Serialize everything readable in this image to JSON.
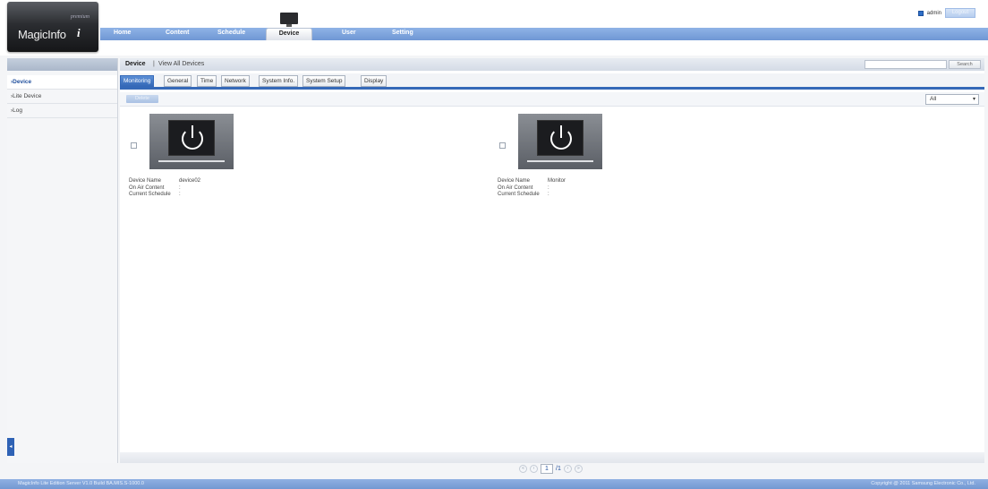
{
  "header": {
    "logo_premium": "premium",
    "logo_brand": "MagicInfo",
    "logo_i": "i",
    "nav": [
      "Home",
      "Content",
      "Schedule",
      "Device",
      "User",
      "Setting"
    ],
    "active_nav": "Device",
    "user": "admin",
    "logout": "Logout"
  },
  "sidebar": {
    "items": [
      "Device",
      "Lite Device",
      "Log"
    ],
    "toggle": "◂"
  },
  "main": {
    "title": "Device",
    "separator": "|",
    "subtitle": "View All Devices",
    "search_button": "Search",
    "search_value": "",
    "tabs": [
      "Monitoring",
      "General",
      "Time",
      "Network",
      "System Info.",
      "System Setup",
      "Display"
    ],
    "clear_button": "Delete",
    "filter_value": "All",
    "filter_arrow": "▾"
  },
  "devices": [
    {
      "name_label": "Device Name",
      "name": "device02",
      "content_label": "On Air Content",
      "content": ":",
      "schedule_label": "Current Schedule",
      "schedule": ":"
    },
    {
      "name_label": "Device Name",
      "name": "Monitor",
      "content_label": "On Air Content",
      "content": ":",
      "schedule_label": "Current Schedule",
      "schedule": ":"
    }
  ],
  "pager": {
    "first": "«",
    "prev": "‹",
    "page": "1",
    "total": "/1",
    "next": "›",
    "last": "»"
  },
  "footer": {
    "left": "MagicInfo Lite Edition Server V1.0 Build BA.MIS.S-1000.0",
    "right": "Copyright @ 2011 Samsung Electronic Co., Ltd."
  }
}
